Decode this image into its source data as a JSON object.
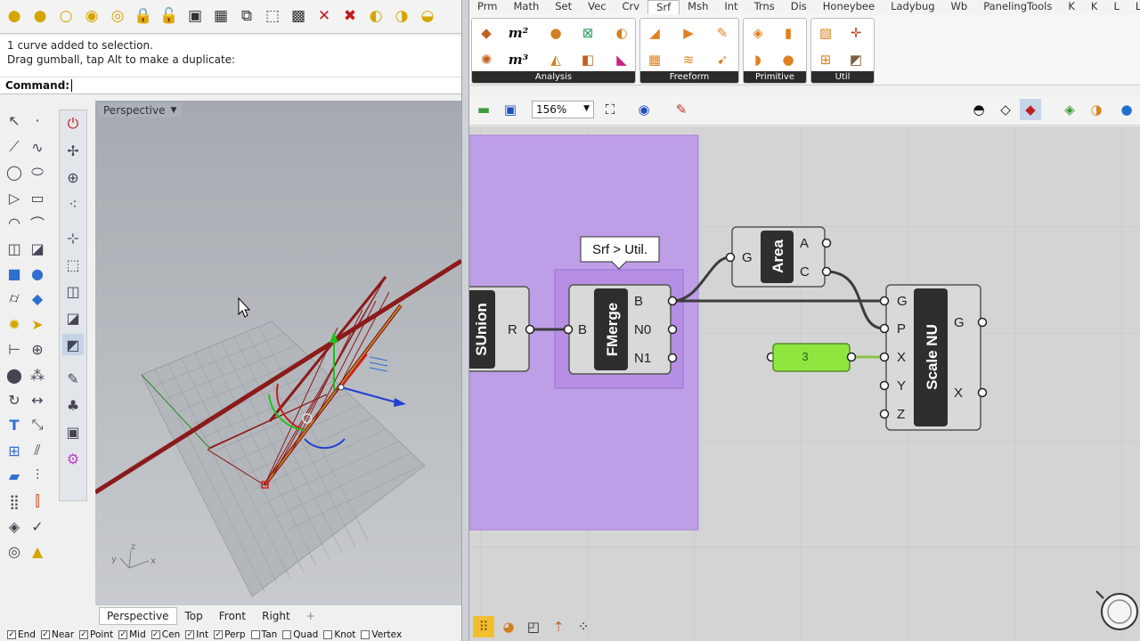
{
  "rhino": {
    "history": [
      "1 curve added to selection.",
      "Drag gumball, tap Alt to make a duplicate:"
    ],
    "command_label": "Command:",
    "command_value": "",
    "viewport_title": "Perspective",
    "viewport_tabs": [
      "Perspective",
      "Top",
      "Front",
      "Right"
    ],
    "add_tab_symbol": "+",
    "axis_x": "x",
    "axis_y": "y",
    "axis_z": "z",
    "osnaps": [
      {
        "label": "End",
        "checked": true
      },
      {
        "label": "Near",
        "checked": true
      },
      {
        "label": "Point",
        "checked": true
      },
      {
        "label": "Mid",
        "checked": true
      },
      {
        "label": "Cen",
        "checked": true
      },
      {
        "label": "Int",
        "checked": true
      },
      {
        "label": "Perp",
        "checked": true
      },
      {
        "label": "Tan",
        "checked": false
      },
      {
        "label": "Quad",
        "checked": false
      },
      {
        "label": "Knot",
        "checked": false
      },
      {
        "label": "Vertex",
        "checked": false
      }
    ]
  },
  "gh": {
    "tabs": [
      "Prm",
      "Math",
      "Set",
      "Vec",
      "Crv",
      "Srf",
      "Msh",
      "Int",
      "Trns",
      "Dis",
      "Honeybee",
      "Ladybug",
      "Wb",
      "PanelingTools",
      "K",
      "K",
      "L",
      "L"
    ],
    "active_tab": "Srf",
    "groups": [
      "Analysis",
      "Freeform",
      "Primitive",
      "Util"
    ],
    "ribbon_text": {
      "m2": "m²",
      "m3": "m³"
    },
    "zoom": "156%",
    "tooltip": "Srf > Util.",
    "components": {
      "sunion": {
        "name": "SUnion",
        "outputs": [
          "R"
        ]
      },
      "fmerge": {
        "name": "FMerge",
        "inputs": [
          "B"
        ],
        "outputs": [
          "B",
          "N0",
          "N1"
        ]
      },
      "area": {
        "name": "Area",
        "inputs": [
          "G"
        ],
        "outputs": [
          "A",
          "C"
        ]
      },
      "scale": {
        "name": "Scale NU",
        "inputs": [
          "G",
          "P",
          "X",
          "Y",
          "Z"
        ],
        "outputs": [
          "G",
          "X"
        ]
      }
    },
    "slider_value": "3"
  },
  "colors": {
    "group_fill": "#bf9ee8",
    "group_border": "#a57fd6",
    "component_body": "#d9d9d9",
    "component_label": "#2e2e2e",
    "slider_green": "#8ee63e",
    "wire": "#3c3c3c",
    "wire_green": "#8bc34a",
    "curve_red": "#8b1a1a"
  }
}
